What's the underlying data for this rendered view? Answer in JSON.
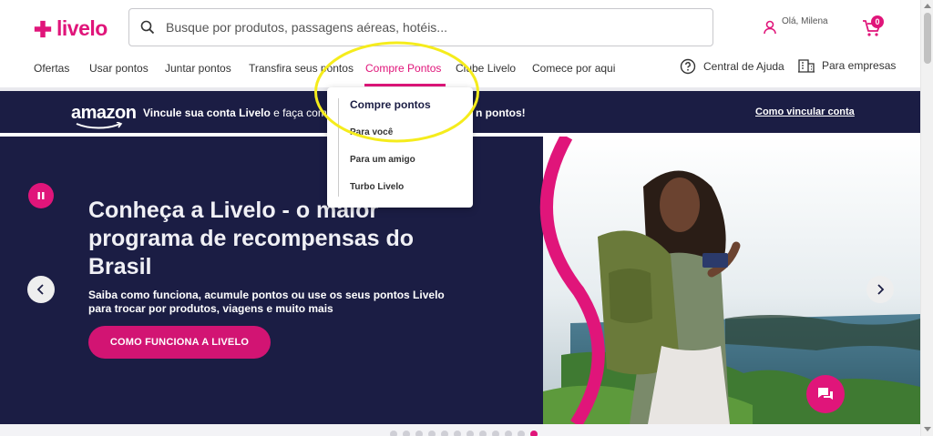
{
  "header": {
    "logo_text": "livelo",
    "search_placeholder": "Busque por produtos, passagens aéreas, hotéis...",
    "user_greeting": "Olá, Milena",
    "cart_count": "0"
  },
  "nav": {
    "items": [
      "Ofertas",
      "Usar pontos",
      "Juntar pontos",
      "Transfira seus pontos",
      "Compre Pontos",
      "Clube Livelo",
      "Comece por aqui"
    ],
    "active": "Compre Pontos",
    "help_label": "Central de Ajuda",
    "business_label": "Para empresas"
  },
  "dropdown": {
    "title": "Compre pontos",
    "items": [
      "Para você",
      "Para um amigo",
      "Turbo Livelo"
    ]
  },
  "amazon_banner": {
    "logo": "amazon",
    "text_bold": "Vincule sua conta Livelo",
    "text_rest": " e faça com",
    "text_end": "n pontos!",
    "link": "Como vincular conta"
  },
  "hero": {
    "title": "Conheça a Livelo - o maior programa de recompensas do Brasil",
    "subtitle": "Saiba como funciona, acumule pontos ou use os seus pontos Livelo para trocar por produtos, viagens e muito mais",
    "cta": "COMO FUNCIONA A LIVELO",
    "slide_count": 12,
    "active_slide": 11
  },
  "colors": {
    "brand": "#e0157a",
    "navy": "#1b1d44"
  }
}
